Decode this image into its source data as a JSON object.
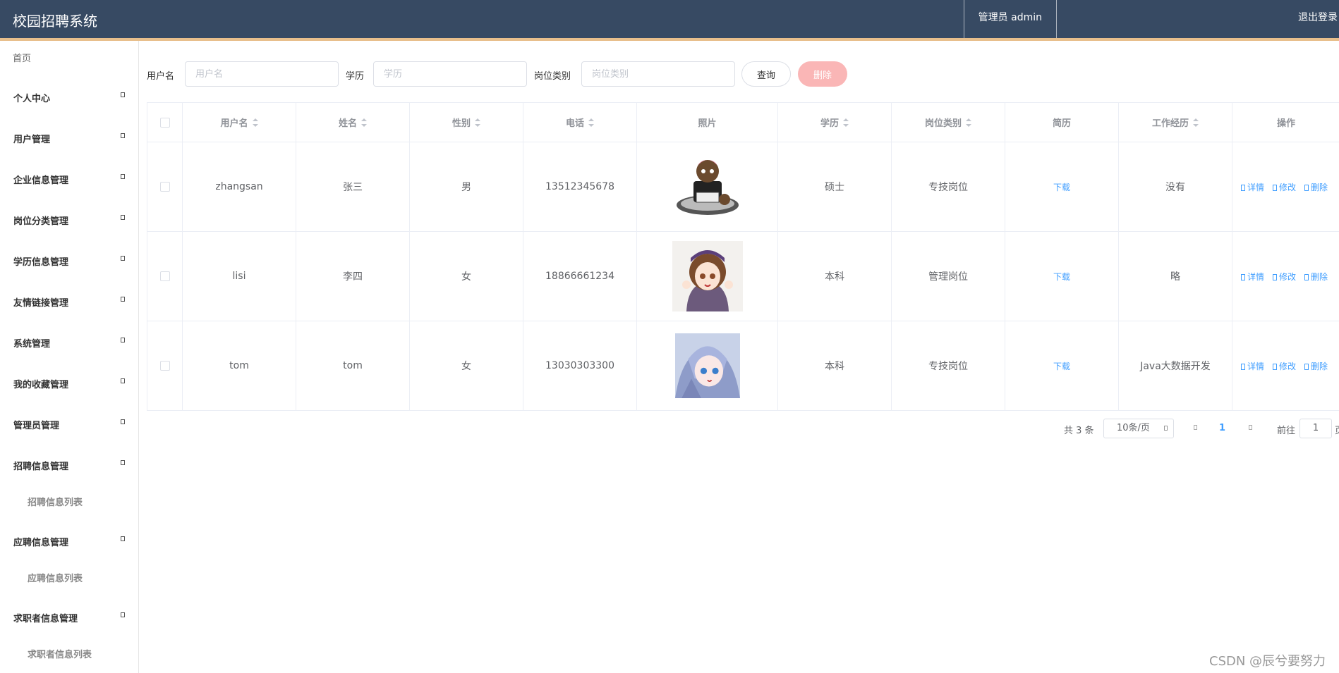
{
  "header": {
    "title": "校园招聘系统",
    "user_label": "管理员 admin",
    "logout_label": "退出登录"
  },
  "sidebar": {
    "home": "首页",
    "items": [
      {
        "label": "个人中心"
      },
      {
        "label": "用户管理"
      },
      {
        "label": "企业信息管理"
      },
      {
        "label": "岗位分类管理"
      },
      {
        "label": "学历信息管理"
      },
      {
        "label": "友情链接管理"
      },
      {
        "label": "系统管理"
      },
      {
        "label": "我的收藏管理"
      },
      {
        "label": "管理员管理"
      },
      {
        "label": "招聘信息管理",
        "sub": "招聘信息列表"
      },
      {
        "label": "应聘信息管理",
        "sub": "应聘信息列表"
      },
      {
        "label": "求职者信息管理",
        "sub": "求职者信息列表"
      }
    ]
  },
  "search": {
    "username_label": "用户名",
    "username_placeholder": "用户名",
    "edu_label": "学历",
    "edu_placeholder": "学历",
    "category_label": "岗位类别",
    "category_placeholder": "岗位类别",
    "query_button": "查询",
    "delete_button": "删除"
  },
  "table": {
    "columns": [
      "用户名",
      "姓名",
      "性别",
      "电话",
      "照片",
      "学历",
      "岗位类别",
      "简历",
      "工作经历",
      "操作"
    ],
    "rows": [
      {
        "username": "zhangsan",
        "name": "张三",
        "gender": "男",
        "phone": "13512345678",
        "edu": "硕士",
        "category": "专技岗位",
        "resume": "下载",
        "experience": "没有"
      },
      {
        "username": "lisi",
        "name": "李四",
        "gender": "女",
        "phone": "18866661234",
        "edu": "本科",
        "category": "管理岗位",
        "resume": "下载",
        "experience": "略"
      },
      {
        "username": "tom",
        "name": "tom",
        "gender": "女",
        "phone": "13030303300",
        "edu": "本科",
        "category": "专技岗位",
        "resume": "下载",
        "experience": "Java大数据开发"
      }
    ],
    "actions": {
      "detail": "详情",
      "edit": "修改",
      "delete": "删除"
    }
  },
  "pager": {
    "total": "共 3 条",
    "size": "10条/页",
    "page": "1",
    "goto": "前往",
    "jump": "1",
    "unit": "页"
  },
  "watermark": "CSDN @辰兮要努力"
}
